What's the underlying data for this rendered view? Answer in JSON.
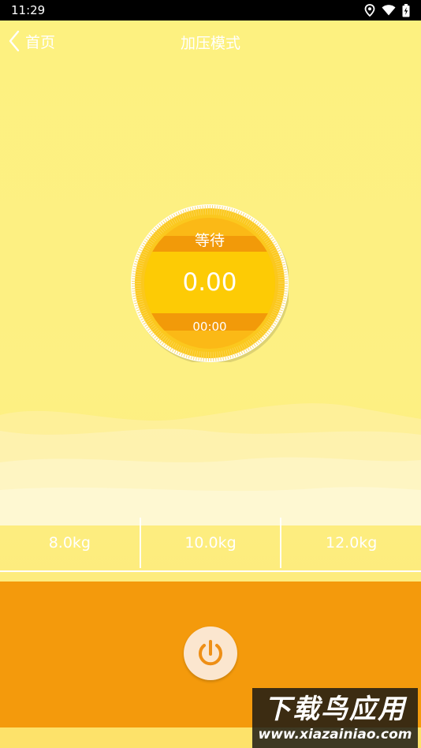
{
  "status": {
    "time": "11:29",
    "icons": [
      "location-icon",
      "wifi-icon",
      "battery-icon"
    ]
  },
  "header": {
    "back_label": "首页",
    "title": "加压模式"
  },
  "gauge": {
    "state": "等待",
    "value": "0.00",
    "timer": "00:00"
  },
  "weights": [
    {
      "label": "8.0kg"
    },
    {
      "label": "10.0kg"
    },
    {
      "label": "12.0kg"
    }
  ],
  "power": {
    "icon": "power-icon"
  },
  "watermark": {
    "line1": "下载鸟应用",
    "line2": "www.xiazainiao.com"
  },
  "colors": {
    "accent_orange": "#f49a0c",
    "gauge_yellow": "#fbc81e",
    "band_orange": "#f29a09",
    "background_yellow": "#fdf080"
  }
}
